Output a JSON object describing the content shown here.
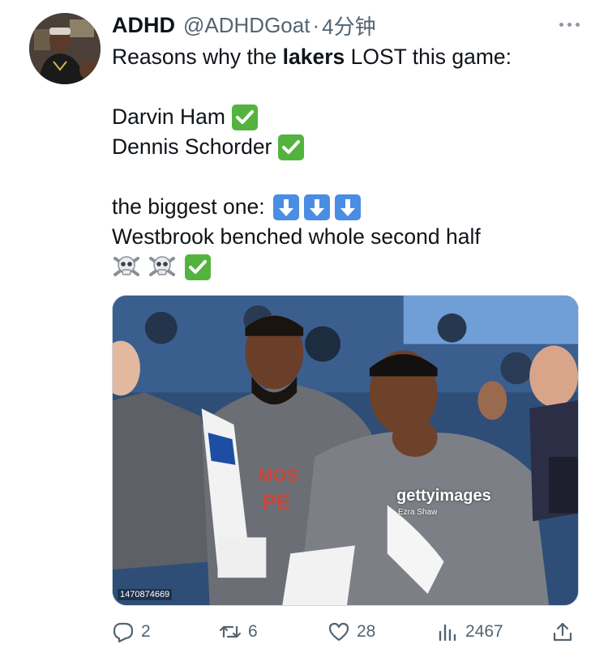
{
  "tweet": {
    "author_name": "ADHD",
    "author_handle": "@ADHDGoat",
    "separator": "·",
    "time": "4分钟",
    "lines": {
      "l1_pre": "Reasons why the ",
      "l1_bold": "lakers",
      "l1_post": " LOST this game:",
      "l2": "Darvin Ham",
      "l3": "Dennis Schorder",
      "l4": "the biggest one:",
      "l5": "Westbrook benched whole second half"
    },
    "emoji": {
      "check": "white-heavy-check-mark-icon",
      "arrow": "down-arrow-button-icon",
      "skull": "skull-and-crossbones-icon"
    }
  },
  "media": {
    "watermark": "gettyimages",
    "watermark_credit": "Ezra Shaw",
    "image_id": "1470874669"
  },
  "actions": {
    "replies": "2",
    "retweets": "6",
    "likes": "28",
    "views": "2467"
  },
  "colors": {
    "text": "#0f1419",
    "secondary": "#536471",
    "check_green": "#53b33e",
    "arrow_blue": "#4a8de3"
  }
}
